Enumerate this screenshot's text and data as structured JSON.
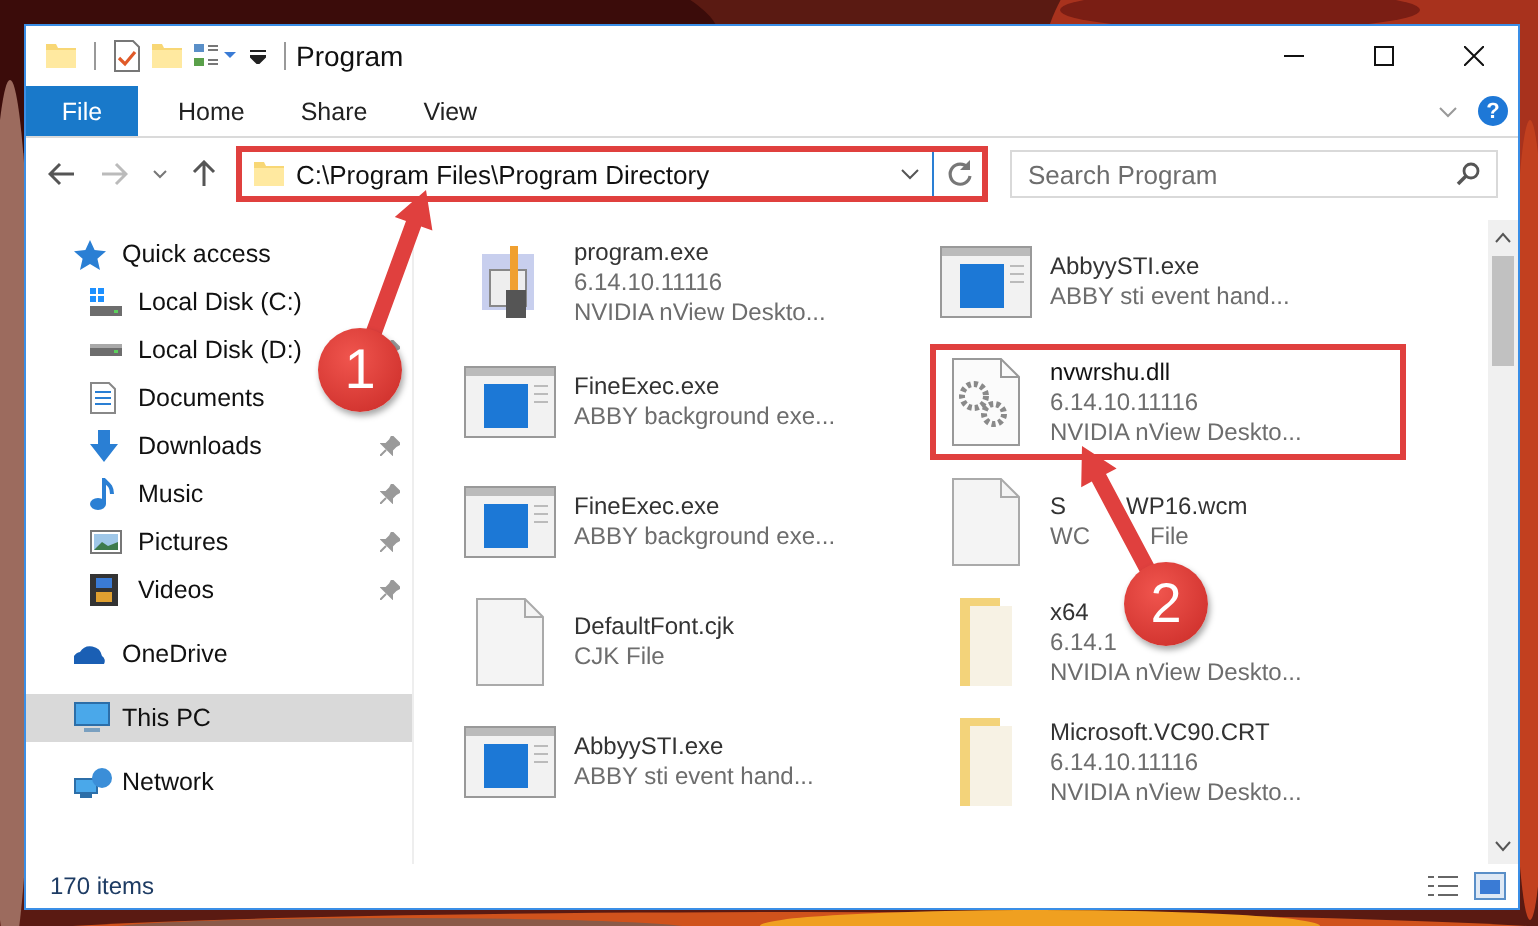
{
  "window": {
    "title": "Program",
    "controls": [
      {
        "kind": "minimize"
      },
      {
        "kind": "maximize"
      },
      {
        "kind": "close"
      }
    ]
  },
  "quick_toolbar": [
    {
      "kind": "folder"
    },
    {
      "kind": "properties"
    },
    {
      "kind": "new-folder"
    },
    {
      "kind": "view"
    },
    {
      "kind": "customize"
    }
  ],
  "ribbon": {
    "tabs": [
      {
        "label": "File",
        "kind": "file",
        "selected": false
      },
      {
        "label": "Home",
        "kind": "tab",
        "selected": false
      },
      {
        "label": "Share",
        "kind": "tab",
        "selected": false
      },
      {
        "label": "View",
        "kind": "tab",
        "selected": false
      }
    ],
    "help": "?"
  },
  "address_bar": {
    "path": "C:\\Program Files\\Program Directory",
    "annotated": true
  },
  "search": {
    "placeholder": "Search Program"
  },
  "sidebar": {
    "items": [
      {
        "label": "Quick access",
        "kind": "star",
        "selected": false,
        "children": [
          {
            "label": "Local Disk (C:)",
            "kind": "system-drive",
            "selected": false,
            "pinned": false
          },
          {
            "label": "Local Disk (D:)",
            "kind": "drive",
            "selected": false,
            "pinned": true
          },
          {
            "label": "Documents",
            "kind": "documents",
            "selected": false,
            "pinned": false
          },
          {
            "label": "Downloads",
            "kind": "downloads",
            "selected": false,
            "pinned": true
          },
          {
            "label": "Music",
            "kind": "music",
            "selected": false,
            "pinned": true
          },
          {
            "label": "Pictures",
            "kind": "pictures",
            "selected": false,
            "pinned": true
          },
          {
            "label": "Videos",
            "kind": "videos",
            "selected": false,
            "pinned": true
          }
        ]
      },
      {
        "label": "OneDrive",
        "kind": "cloud",
        "selected": false
      },
      {
        "label": "This PC",
        "kind": "pc",
        "selected": true
      },
      {
        "label": "Network",
        "kind": "network",
        "selected": false
      }
    ]
  },
  "files": [
    {
      "name": "program.exe",
      "details": [
        "6.14.10.11116",
        "NVIDIA nView Deskto..."
      ],
      "kind": "setup",
      "annotated": false
    },
    {
      "name": "AbbyySTI.exe",
      "details": [
        "ABBY sti event hand..."
      ],
      "kind": "app",
      "annotated": false
    },
    {
      "name": "FineExec.exe",
      "details": [
        "ABBY background exe..."
      ],
      "kind": "app",
      "annotated": false
    },
    {
      "name": "nvwrshu.dll",
      "details": [
        "6.14.10.11116",
        "NVIDIA nView Deskto..."
      ],
      "kind": "gears",
      "annotated": true
    },
    {
      "name": "FineExec.exe",
      "details": [
        "ABBY background exe..."
      ],
      "kind": "app",
      "annotated": false
    },
    {
      "name": [
        "S",
        "WP16.wcm"
      ],
      "details": [
        [
          "WC",
          "File"
        ]
      ],
      "kind": "blank",
      "annotated": false
    },
    {
      "name": "DefaultFont.cjk",
      "details": [
        "CJK File"
      ],
      "kind": "blank",
      "annotated": false
    },
    {
      "name": "x64",
      "details": [
        "6.14.1",
        "NVIDIA nView Deskto..."
      ],
      "kind": "folder",
      "annotated": false
    },
    {
      "name": "AbbyySTI.exe",
      "details": [
        "ABBY sti event hand..."
      ],
      "kind": "app",
      "annotated": false
    },
    {
      "name": "Microsoft.VC90.CRT",
      "details": [
        "6.14.10.11116",
        "NVIDIA nView Deskto..."
      ],
      "kind": "folder",
      "annotated": false
    }
  ],
  "status_bar": {
    "count": "170 items"
  },
  "callouts": [
    {
      "number": "1"
    },
    {
      "number": "2"
    }
  ]
}
